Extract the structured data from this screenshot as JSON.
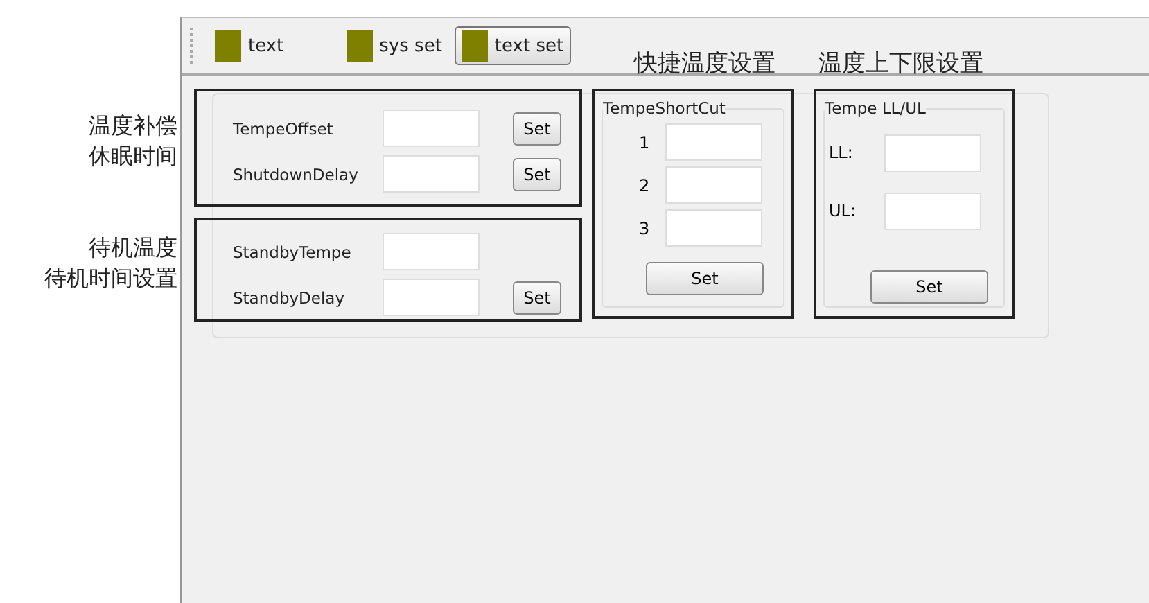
{
  "toolbar": {
    "buttons": [
      {
        "label": "text",
        "selected": false
      },
      {
        "label": "sys set",
        "selected": false
      },
      {
        "label": "text set",
        "selected": true
      }
    ]
  },
  "headings": [
    "快捷温度设置",
    "温度上下限设置"
  ],
  "side_notes": [
    {
      "lines": [
        "温度补偿",
        "休眠时间"
      ]
    },
    {
      "lines": [
        "待机温度",
        "待机时间设置"
      ]
    }
  ],
  "setting_groups": [
    {
      "rows": [
        {
          "label": "TempeOffset",
          "button": "Set"
        },
        {
          "label": "ShutdownDelay",
          "button": "Set"
        }
      ]
    },
    {
      "rows": [
        {
          "label": "StandbyTempe"
        },
        {
          "label": "StandbyDelay",
          "button": "Set"
        }
      ]
    }
  ],
  "shortcut": {
    "title": "TempeShortCut",
    "rows": [
      "1",
      "2",
      "3"
    ],
    "button": "Set"
  },
  "limits": {
    "title": "Tempe LL/UL",
    "rows": [
      "LL:",
      "UL:"
    ],
    "button": "Set"
  }
}
